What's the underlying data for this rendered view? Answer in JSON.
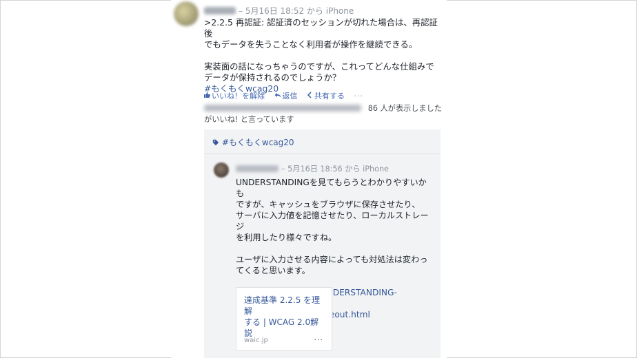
{
  "post": {
    "meta": "– 5月16日 18:52 から iPhone",
    "paragraphs": [
      ">2.2.5 再認証: 認証済のセッションが切れた場合は、再認証後",
      "でもデータを失うことなく利用者が操作を継続できる。",
      "実装面の話になっちゃうのですが、これってどんな仕組みで",
      "データが保持されるのでしょうか？"
    ],
    "hashtag": "#もくもくwcag20",
    "actions": {
      "unlike": "いいね！を解除",
      "reply": "返信",
      "share": "共有する",
      "more": "···"
    },
    "seen": "86 人が表示しました",
    "likes_tail": "がいいね! と言っています"
  },
  "comment_section": {
    "tag": "#もくもくwcag20",
    "comment": {
      "meta": "– 5月16日 18:56 から iPhone",
      "lines": [
        "UNDERSTANDINGを見てもらうとわかりやすいかも",
        "ですが、キャッシュをブラウザに保存させたり、",
        "サーバに入力値を記憶させたり、ローカルストレージ",
        "を利用したり様々ですね。",
        "ユーザに入力させる内容によっても対処法は変わっ",
        "てくると思います。"
      ],
      "link_line1": "https://waic.jp/docs/UNDERSTANDING-WCAG20",
      "link_line2": "/time-limits-server-timeout.html",
      "card": {
        "title_line1": "達成基準 2.2.5 を理解",
        "title_line2": "する | WCAG 2.0解説",
        "domain": "waic.jp",
        "more": "···"
      }
    }
  },
  "icons": [
    "thumbs-up-icon",
    "reply-icon",
    "share-icon",
    "tag-icon",
    "more-icon"
  ],
  "colors": {
    "link": "#365899",
    "action": "#4267b2",
    "muted": "#8d949e",
    "comment_bg": "#f2f3f5"
  }
}
